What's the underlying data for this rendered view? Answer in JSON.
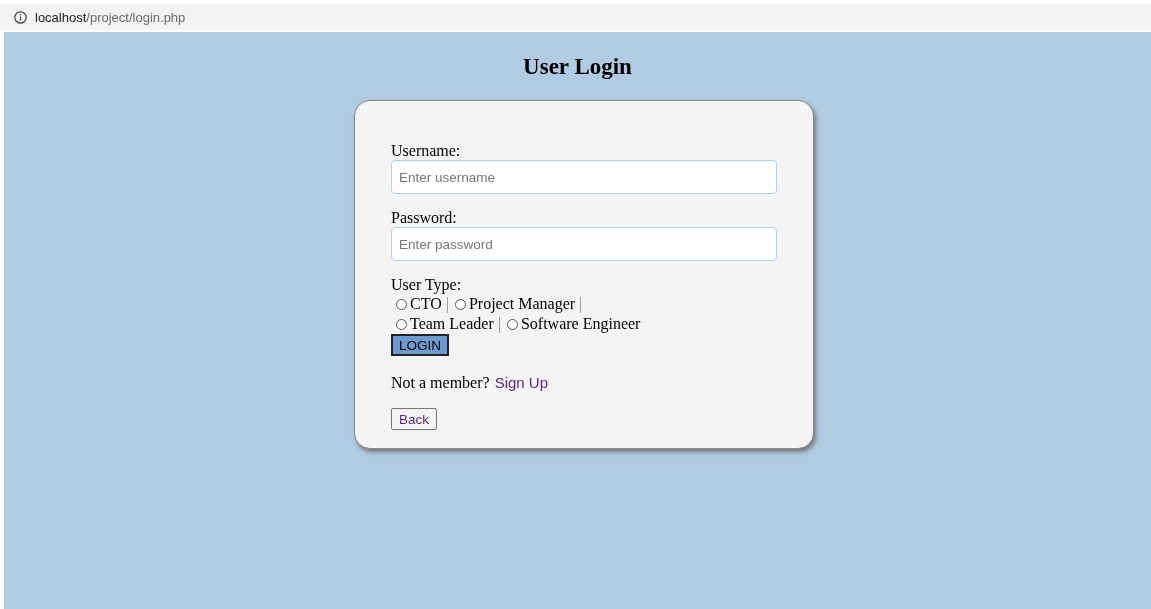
{
  "address_bar": {
    "host": "localhost",
    "path": "/project/login.php"
  },
  "title": "User Login",
  "fields": [
    {
      "label": "Username:",
      "placeholder": "Enter username"
    },
    {
      "label": "Password:",
      "placeholder": "Enter password"
    }
  ],
  "user_type": {
    "label": "User Type:",
    "rows": [
      [
        {
          "label": "CTO",
          "selected": false,
          "separator": "|"
        },
        {
          "label": "Project Manager",
          "selected": false,
          "separator": "|"
        }
      ],
      [
        {
          "label": "Team Leader",
          "selected": false,
          "separator": "|"
        },
        {
          "label": "Software Engineer",
          "selected": false
        }
      ]
    ]
  },
  "login_button": "LOGIN",
  "signup": {
    "text": "Not a member?",
    "link": "Sign Up"
  },
  "back_button": "Back"
}
